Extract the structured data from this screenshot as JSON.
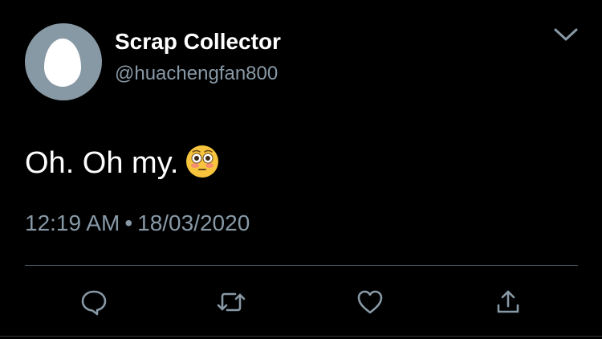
{
  "tweet": {
    "display_name": "Scrap Collector",
    "handle": "@huachengfan800",
    "text": "Oh. Oh my.",
    "emoji": "flushed-face",
    "time": "12:19 AM",
    "separator": "•",
    "date": "18/03/2020"
  },
  "icons": {
    "menu": "chevron-down-icon",
    "reply": "reply-icon",
    "retweet": "retweet-icon",
    "like": "heart-icon",
    "share": "share-icon"
  },
  "colors": {
    "background": "#000000",
    "primary_text": "#ffffff",
    "secondary_text": "#8899a6",
    "divider": "#3d4e5c",
    "avatar_bg": "#8899a6",
    "emoji_face": "#f7c43d"
  }
}
